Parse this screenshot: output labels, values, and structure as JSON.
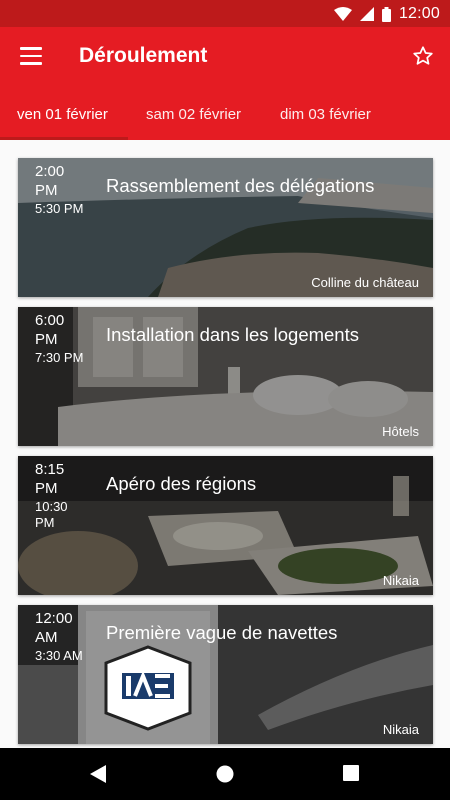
{
  "status": {
    "time": "12:00"
  },
  "app": {
    "title": "Déroulement"
  },
  "tabs": [
    {
      "label": "ven 01 février",
      "selected": true
    },
    {
      "label": "sam 02 février",
      "selected": false
    },
    {
      "label": "dim 03 février",
      "selected": false
    }
  ],
  "events": [
    {
      "start_time": "2:00",
      "start_ampm": "PM",
      "end": "5:30 PM",
      "title": "Rassemblement des délégations",
      "location": "Colline du château"
    },
    {
      "start_time": "6:00",
      "start_ampm": "PM",
      "end": "7:30 PM",
      "title": "Installation dans les logements",
      "location": "Hôtels"
    },
    {
      "start_time": "8:15",
      "start_ampm": "PM",
      "end": "10:30 PM",
      "title": "Apéro des régions",
      "location": "Nikaia"
    },
    {
      "start_time": "12:00",
      "start_ampm": "AM",
      "end": "3:30 AM",
      "title": "Première vague de navettes",
      "location": "Nikaia"
    }
  ],
  "colors": {
    "primary": "#e51c23",
    "primary_dark": "#bd1a1b"
  }
}
